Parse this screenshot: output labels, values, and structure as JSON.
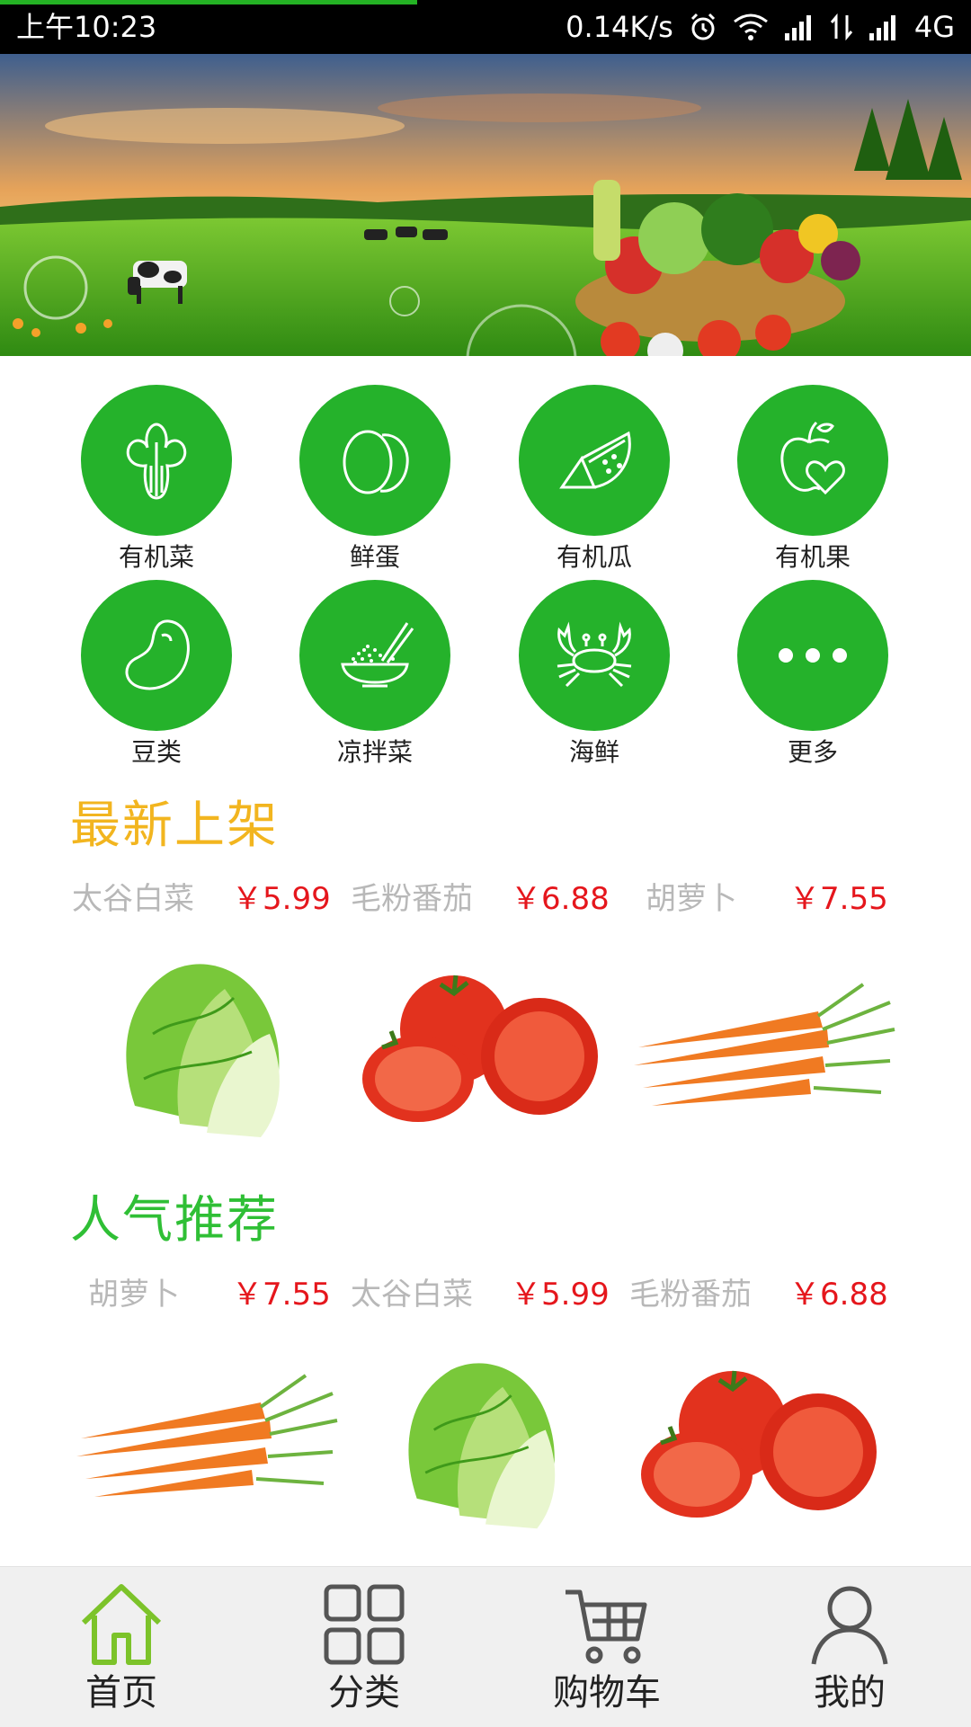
{
  "status_bar": {
    "time": "上午10:23",
    "speed": "0.14K/s",
    "network": "4G"
  },
  "banner": {
    "image": "farm-vegetables-banner"
  },
  "categories": [
    {
      "label": "有机菜",
      "icon": "bok-choy-icon"
    },
    {
      "label": "鲜蛋",
      "icon": "eggs-icon"
    },
    {
      "label": "有机瓜",
      "icon": "watermelon-slice-icon"
    },
    {
      "label": "有机果",
      "icon": "apple-heart-icon"
    },
    {
      "label": "豆类",
      "icon": "bean-icon"
    },
    {
      "label": "凉拌菜",
      "icon": "rice-bowl-icon"
    },
    {
      "label": "海鲜",
      "icon": "crab-icon"
    },
    {
      "label": "更多",
      "icon": "more-dots-icon"
    }
  ],
  "new_arrivals": {
    "title": "最新上架",
    "products": [
      {
        "name": "太谷白菜",
        "price": "￥5.99",
        "image": "cabbage"
      },
      {
        "name": "毛粉番茄",
        "price": "￥6.88",
        "image": "tomato"
      },
      {
        "name": "胡萝卜",
        "price": "￥7.55",
        "image": "carrot"
      }
    ]
  },
  "popular": {
    "title": "人气推荐",
    "products": [
      {
        "name": "胡萝卜",
        "price": "￥7.55",
        "image": "carrot"
      },
      {
        "name": "太谷白菜",
        "price": "￥5.99",
        "image": "cabbage"
      },
      {
        "name": "毛粉番茄",
        "price": "￥6.88",
        "image": "tomato"
      }
    ]
  },
  "bottom_nav": [
    {
      "label": "首页",
      "icon": "home-icon",
      "active": true
    },
    {
      "label": "分类",
      "icon": "grid-icon",
      "active": false
    },
    {
      "label": "购物车",
      "icon": "cart-icon",
      "active": false
    },
    {
      "label": "我的",
      "icon": "user-icon",
      "active": false
    }
  ],
  "colors": {
    "brand_green": "#25b22b",
    "new_title": "#f2b51f",
    "popular_title": "#2fbf35",
    "price_red": "#e5161c"
  }
}
